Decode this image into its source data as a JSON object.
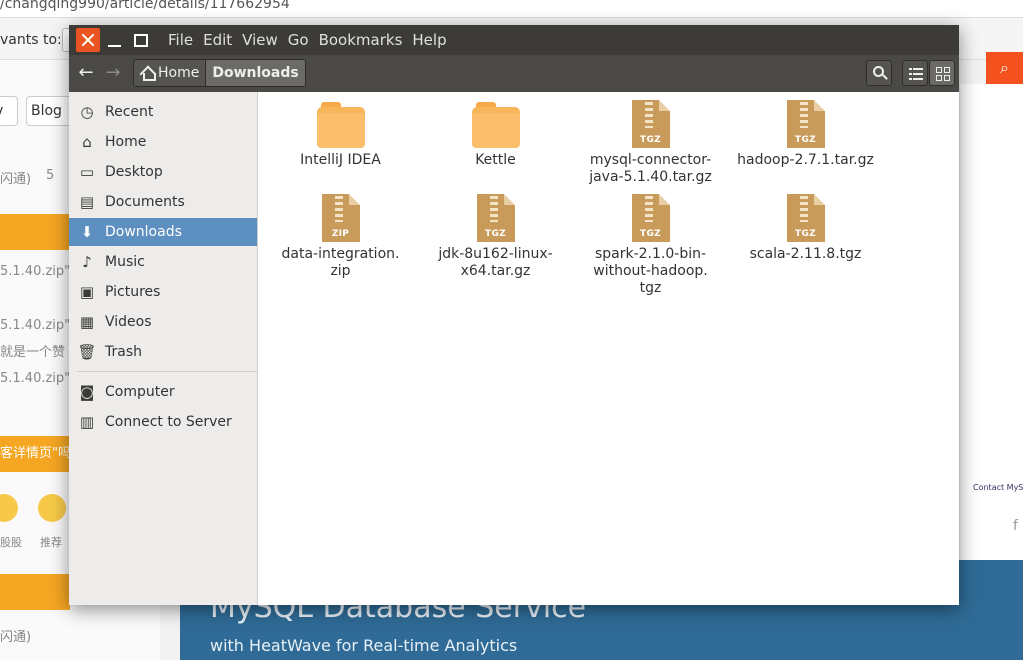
{
  "browser_bg": {
    "url_text": "/changqing990/article/details/117662954",
    "wants_to": "vants to:",
    "pill_left": "v",
    "pill_mid": "Blog",
    "meta_left": "闪通)",
    "meta_eye": "5",
    "snippet1": "5.1.40.zip\"",
    "snippet2": "5.1.40.zip\"",
    "snippet3": "就是一个赞",
    "snippet4": "5.1.40.zip\"",
    "orange_strip": "客详情页\"吗",
    "emoji_label1": "股股",
    "emoji_label2": "推荐",
    "meta_bottom": "闪通)",
    "contact": "Contact MySQ",
    "fb": "f",
    "banner_title": "MySQL Database Service",
    "banner_sub": "with HeatWave for Real-time Analytics"
  },
  "window": {
    "menu": [
      "File",
      "Edit",
      "View",
      "Go",
      "Bookmarks",
      "Help"
    ],
    "breadcrumb": {
      "home": "Home",
      "current": "Downloads"
    },
    "sidebar": [
      {
        "label": "Recent",
        "icon": "clock-icon",
        "glyph": "◷"
      },
      {
        "label": "Home",
        "icon": "home-icon",
        "glyph": "⌂"
      },
      {
        "label": "Desktop",
        "icon": "desktop-icon",
        "glyph": "▭"
      },
      {
        "label": "Documents",
        "icon": "document-icon",
        "glyph": "▤"
      },
      {
        "label": "Downloads",
        "icon": "download-icon",
        "glyph": "⬇",
        "selected": true
      },
      {
        "label": "Music",
        "icon": "music-icon",
        "glyph": "♪"
      },
      {
        "label": "Pictures",
        "icon": "picture-icon",
        "glyph": "▣"
      },
      {
        "label": "Videos",
        "icon": "film-icon",
        "glyph": "▦"
      },
      {
        "label": "Trash",
        "icon": "trash-icon",
        "glyph": "🗑"
      },
      {
        "label": "Computer",
        "icon": "computer-icon",
        "glyph": "◙"
      },
      {
        "label": "Connect to Server",
        "icon": "server-icon",
        "glyph": "▥"
      }
    ],
    "files": [
      {
        "name": "IntelliJ IDEA",
        "kind": "folder"
      },
      {
        "name": "Kettle",
        "kind": "folder"
      },
      {
        "name": "mysql-connector-java-5.1.40.tar.gz",
        "kind": "archive",
        "tag": "TGZ",
        "lines": [
          "mysql-connector-",
          "java-5.1.40.tar.gz"
        ]
      },
      {
        "name": "hadoop-2.7.1.tar.gz",
        "kind": "archive",
        "tag": "TGZ",
        "lines": [
          "hadoop-2.7.1.tar.gz"
        ]
      },
      {
        "name": "data-integration.zip",
        "kind": "archive",
        "tag": "ZIP",
        "lines": [
          "data-integration.",
          "zip"
        ]
      },
      {
        "name": "jdk-8u162-linux-x64.tar.gz",
        "kind": "archive",
        "tag": "TGZ",
        "lines": [
          "jdk-8u162-linux-",
          "x64.tar.gz"
        ]
      },
      {
        "name": "spark-2.1.0-bin-without-hadoop.tgz",
        "kind": "archive",
        "tag": "TGZ",
        "lines": [
          "spark-2.1.0-bin-",
          "without-hadoop.",
          "tgz"
        ]
      },
      {
        "name": "scala-2.11.8.tgz",
        "kind": "archive",
        "tag": "TGZ",
        "lines": [
          "scala-2.11.8.tgz"
        ]
      }
    ]
  },
  "colors": {
    "accent": "#e95420",
    "selection": "#5d8fc0",
    "titlebar": "#3c3b37",
    "folder": "#f7b65a",
    "archive": "#c89b5b"
  }
}
